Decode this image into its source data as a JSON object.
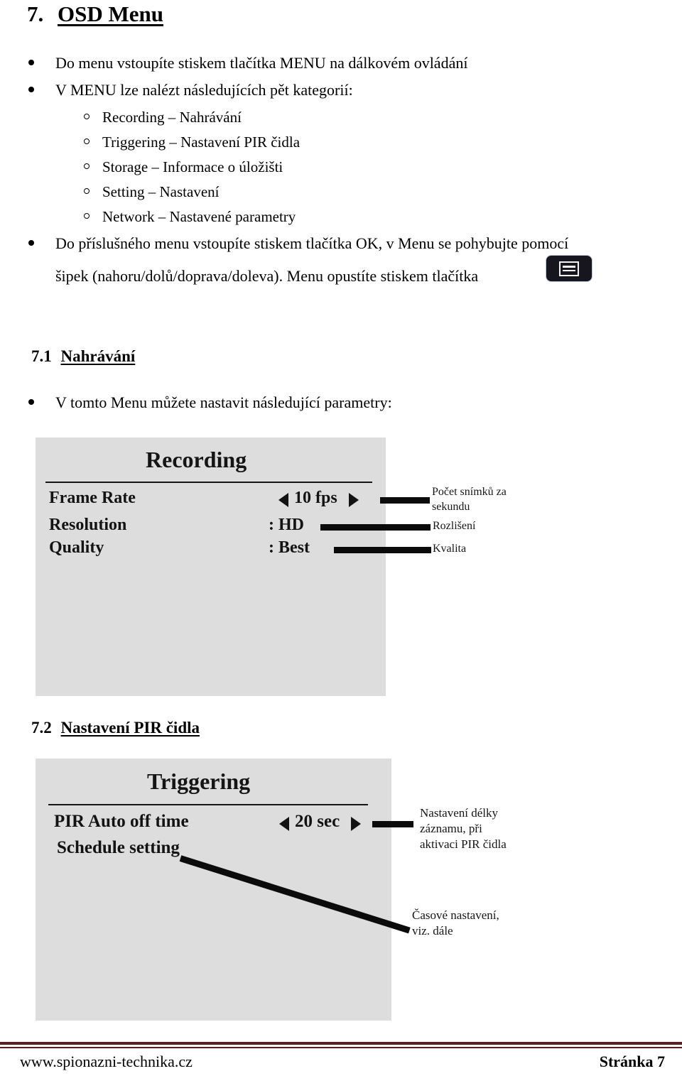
{
  "document": {
    "section_heading": {
      "number": "7.",
      "title": "OSD Menu"
    },
    "bullets": [
      "Do menu vstoupíte stiskem tlačítka MENU na dálkovém ovládání",
      "V MENU lze nalézt následujících pět kategorií:"
    ],
    "categories": [
      "Recording – Nahrávání",
      "Triggering – Nastavení PIR čidla",
      "Storage – Informace o úložišti",
      "Setting – Nastavení",
      "Network – Nastavené parametry"
    ],
    "navigation_bullet": {
      "line1": "Do příslušného menu vstoupíte stiskem tlačítka OK, v Menu se pohybujte pomocí",
      "line2": "šipek (nahoru/dolů/doprava/doleva). Menu opustíte stiskem tlačítka",
      "button_icon": "menu-button-icon"
    },
    "subsection_71": {
      "number": "7.1",
      "title": "Nahrávání",
      "bullet": "V tomto Menu můžete nastavit následující parametry:"
    },
    "subsection_72": {
      "number": "7.2",
      "title": "Nastavení PIR čidla"
    }
  },
  "recording_screenshot": {
    "title": "Recording",
    "rows": [
      {
        "label": "Frame Rate",
        "value": "10 fps",
        "has_arrows": true,
        "annotation": "Počet snímků za\nsekundu",
        "annotation_line1": "Počet snímků za",
        "annotation_line2": "sekundu"
      },
      {
        "label": "Resolution",
        "value": ": HD",
        "has_arrows": false,
        "annotation": "Rozlišení"
      },
      {
        "label": "Quality",
        "value": ": Best",
        "has_arrows": false,
        "annotation": "Kvalita"
      }
    ]
  },
  "triggering_screenshot": {
    "title": "Triggering",
    "rows": [
      {
        "label": "PIR Auto off time",
        "value": "20 sec",
        "has_arrows": true
      },
      {
        "label": "Schedule setting",
        "value": "",
        "has_arrows": false
      }
    ],
    "annotation_1": {
      "line1": "Nastavení délky",
      "line2": "záznamu, při",
      "line3": "aktivaci PIR čidla"
    },
    "annotation_2": {
      "line1": "Časové nastavení,",
      "line2": "viz. dále"
    }
  },
  "footer": {
    "website": "www.spionazni-technika.cz",
    "page_label": "Stránka 7"
  },
  "colors": {
    "footer_rule": "#5c1f1b",
    "screenshot_background": "#dddddd",
    "text": "#000000",
    "button_background": "#17161e"
  }
}
